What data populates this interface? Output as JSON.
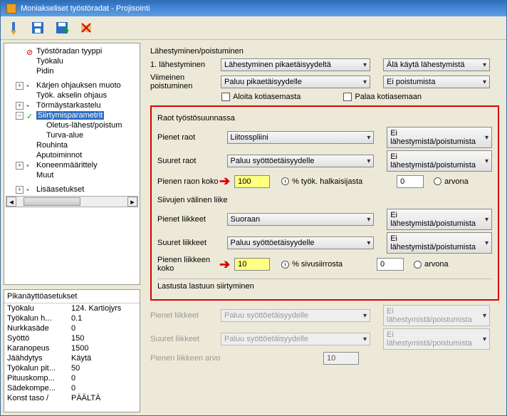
{
  "window": {
    "title": "Moniakseliset työstöradat - Projisointi"
  },
  "tree": {
    "items": [
      "Työstöradan tyyppi",
      "Työkalu",
      "Pidin",
      "Kärjen ohjauksen muoto",
      "Työk. akselin ohjaus",
      "Törmäystarkastelu",
      "Siirtymisparametrit",
      "Oletus-lähest/poistum",
      "Turva-alue",
      "Rouhinta",
      "Aputoiminnot",
      "Koneenmäärittely",
      "Muut",
      "Lisäasetukset"
    ]
  },
  "quick": {
    "title": "Pikanäyttöasetukset",
    "rows": [
      {
        "k": "Työkalu",
        "v": "124. Kartiojyrs"
      },
      {
        "k": "Työkalun h...",
        "v": "0.1"
      },
      {
        "k": "Nurkkasäde",
        "v": "0"
      },
      {
        "k": "Syöttö",
        "v": "150"
      },
      {
        "k": "Karanopeus",
        "v": "1500"
      },
      {
        "k": "Jäähdytys",
        "v": "Käytä"
      },
      {
        "k": "Työkalun pit...",
        "v": "50"
      },
      {
        "k": "Pituuskomp...",
        "v": "0"
      },
      {
        "k": "Sädekompe...",
        "v": "0"
      },
      {
        "k": "Konst taso /",
        "v": "PÄÄLTÄ"
      }
    ]
  },
  "right": {
    "sec1_title": "Lähestyminen/poistuminen",
    "r1_lbl": "1. lähestyminen",
    "r1_sel": "Lähestyminen pikaetäisyydeltä",
    "r1_sel2": "Älä käytä lähestymistä",
    "r2_lbl": "Viimeinen poistuminen",
    "r2_sel": "Paluu pikaetäisyydelle",
    "r2_sel2": "Ei poistumista",
    "chk1": "Aloita kotiasemasta",
    "chk2": "Palaa kotiasemaan",
    "box1_title": "Raot työstösuunnassa",
    "pr_lbl": "Pienet raot",
    "pr_sel": "Liitosspliini",
    "sr_lbl": "Suuret raot",
    "sr_sel": "Paluu syöttöetäisyydelle",
    "side_sel": "Ei lähestymistä/poistumista",
    "prk_lbl": "Pienen raon koko",
    "prk_val": "100",
    "prk_radio": "% työk. halkaisijasta",
    "arvona": "arvona",
    "arvona_val": "0",
    "box2_title": "Siivujen välinen liike",
    "pl_lbl": "Pienet liikkeet",
    "pl_sel": "Suoraan",
    "sl_lbl": "Suuret liikkeet",
    "sl_sel": "Paluu syöttöetäisyydelle",
    "plk_lbl": "Pienen liikkeen koko",
    "plk_val": "10",
    "plk_radio": "% sivusiirrosta",
    "last_cut": "Lastusta lastuun siirtyminen",
    "dis_pl": "Pienet liikkeet",
    "dis_pl_sel": "Paluu syöttöetäisyydelle",
    "dis_sl": "Suuret liikkeet",
    "dis_sl_sel": "Paluu syöttöetäisyydelle",
    "dis_side": "Ei lähestymistä/poistumista",
    "plka_lbl": "Pienen liikkeen arvo",
    "plka_val": "10"
  }
}
